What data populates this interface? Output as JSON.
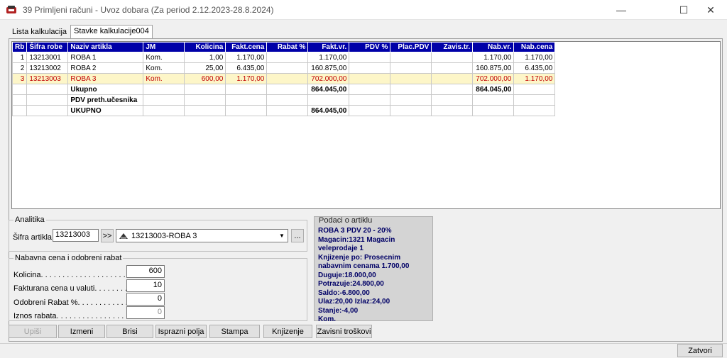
{
  "window": {
    "title": "39 Primljeni računi - Uvoz dobara  (Za period 2.12.2023-28.8.2024)",
    "minimize_glyph": "—",
    "maximize_glyph": "☐",
    "close_glyph": "✕"
  },
  "tabs": [
    {
      "label": "Lista kalkulacija",
      "active": false
    },
    {
      "label": "Stavke kalkulacije004",
      "active": true
    }
  ],
  "grid": {
    "columns": [
      "Rb",
      "Šifra robe",
      "Naziv artikla",
      "JM",
      "Kolicina",
      "Fakt.cena",
      "Rabat %",
      "Fakt.vr.",
      "PDV %",
      "Plac.PDV",
      "Zavis.tr.",
      "Nab.vr.",
      "Nab.cena"
    ],
    "rows": [
      {
        "rb": "1",
        "sifra": "13213001",
        "naziv": "ROBA 1",
        "jm": "Kom.",
        "kolicina": "1,00",
        "fakt_cena": "1.170,00",
        "rabat": "",
        "fakt_vr": "1.170,00",
        "pdv": "",
        "plac_pdv": "",
        "zavis": "",
        "nab_vr": "1.170,00",
        "nab_cena": "1.170,00"
      },
      {
        "rb": "2",
        "sifra": "13213002",
        "naziv": "ROBA 2",
        "jm": "Kom.",
        "kolicina": "25,00",
        "fakt_cena": "6.435,00",
        "rabat": "",
        "fakt_vr": "160.875,00",
        "pdv": "",
        "plac_pdv": "",
        "zavis": "",
        "nab_vr": "160.875,00",
        "nab_cena": "6.435,00"
      },
      {
        "rb": "3",
        "sifra": "13213003",
        "naziv": "ROBA 3",
        "jm": "Kom.",
        "kolicina": "600,00",
        "fakt_cena": "1.170,00",
        "rabat": "",
        "fakt_vr": "702.000,00",
        "pdv": "",
        "plac_pdv": "",
        "zavis": "",
        "nab_vr": "702.000,00",
        "nab_cena": "1.170,00"
      }
    ],
    "summary": {
      "ukupno_label": "Ukupno",
      "ukupno_fakt_vr": "864.045,00",
      "ukupno_nab_vr": "864.045,00",
      "pdv_label": "PDV preth.učesnika",
      "total_label": "UKUPNO",
      "total_fakt_vr": "864.045,00"
    }
  },
  "analitika": {
    "legend": "Analitika",
    "sifra_label": "Šifra artikla.",
    "sifra_value": "13213003",
    "jump_button": ">>",
    "combo_value": "13213003-ROBA 3",
    "ellipsis_button": "..."
  },
  "nabavna": {
    "legend": "Nabavna cena i odobreni rabat",
    "fields": [
      {
        "label": "Kolicina. . . . . . . . . . . . . . . . . . . . . . . .",
        "value": "600",
        "disabled": false
      },
      {
        "label": "Fakturana cena u valuti. . . . . . . . . . .",
        "value": "10",
        "disabled": false
      },
      {
        "label": "Odobreni Rabat %. . . . . . . . . . . . . . .",
        "value": "0",
        "disabled": false
      },
      {
        "label": "Iznos rabata. . . . . . . . . . . . . . . . . . .",
        "value": "0",
        "disabled": true
      }
    ]
  },
  "podaci": {
    "legend": "Podaci o artiklu",
    "lines": [
      "ROBA 3 PDV 20 - 20%",
      "Magacin:1321 Magacin",
      "veleprodaje 1",
      "Knjizenje po: Prosecnim",
      "nabavnim cenama 1.700,00",
      "Duguje:18.000,00",
      "Potrazuje:24.800,00",
      "Saldo:-6.800,00",
      "Ulaz:20,00 Izlaz:24,00 Stanje:-4,00",
      "Kom."
    ]
  },
  "buttons": {
    "upisi": "Upiši",
    "izmeni": "Izmeni",
    "brisi": "Brisi",
    "isprazni": "Isprazni polja",
    "stampa": "Stampa",
    "knjizenje": "Knjizenje",
    "zavisni": "Zavisni troškovi",
    "zatvori": "Zatvori"
  }
}
